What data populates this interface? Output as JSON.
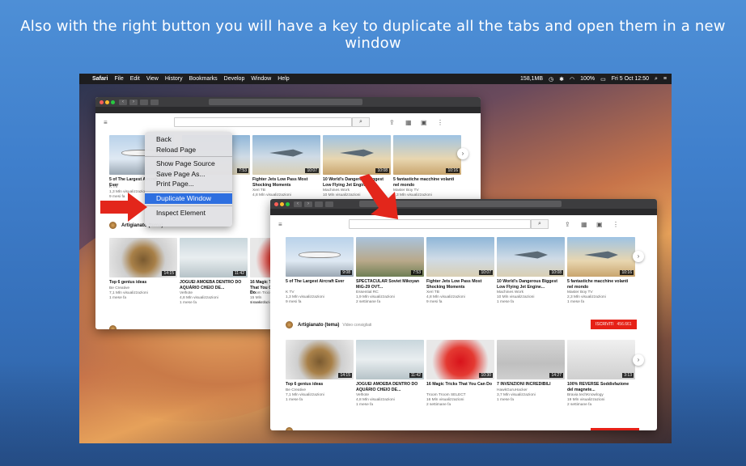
{
  "headline": "Also with the right button you will have a key to duplicate all the tabs and open them in a new window",
  "menubar": {
    "apple": "",
    "items": [
      "Safari",
      "File",
      "Edit",
      "View",
      "History",
      "Bookmarks",
      "Develop",
      "Window",
      "Help"
    ],
    "status": {
      "net": "158,1MB",
      "battery": "100%",
      "datetime": "Fri 5 Oct 12:50"
    }
  },
  "context_menu": {
    "items": [
      "Back",
      "Reload Page",
      "Show Page Source",
      "Save Page As...",
      "Print Page...",
      "Duplicate Window",
      "Inspect Element"
    ],
    "highlighted": "Duplicate Window"
  },
  "window_back": {
    "videos_row1": [
      {
        "title": "5 of The Largest Aircraft Ever",
        "channel": "K TV",
        "views": "1,3 Mln visualizzazioni",
        "ago": "9 mesi fa",
        "duration": ""
      },
      {
        "title": "Fighter Jets Low Pass Most Shocking Moments",
        "channel": "Xeri TB",
        "views": "4,8 Mln visualizzazioni",
        "ago": "",
        "duration": "7:53"
      },
      {
        "title": "10 World's Dangerous Biggest Low Flying Jet Engine...",
        "channel": "Machines Work",
        "views": "10 Mln visualizzazioni",
        "ago": "",
        "duration": "10:07"
      },
      {
        "title": "5 fantastiche macchine volanti nel mondo",
        "channel": "Master Boy TV",
        "views": "2,3 Mln visualizzazioni",
        "ago": "",
        "duration": "10:08"
      }
    ],
    "extra_duration": "10:16",
    "channel_name": "Artigianato (tema)",
    "videos_row2": [
      {
        "title": "Top 6 genius ideas",
        "channel": "Be Creative",
        "views": "7,1 Mln visualizzazioni",
        "ago": "1 mese fa",
        "duration": "14:15"
      },
      {
        "title": "JOGUEI AMOEBA DENTRO DO AQUÁRIO CHEIO DE...",
        "channel": "Velhote",
        "views": "4,8 Mln visualizzazioni",
        "ago": "1 mese fa",
        "duration": "11:42"
      },
      {
        "title": "16 Magic Tricks That You Can Do",
        "channel": "Troom Troom",
        "views": "15 Mln visualizzazioni",
        "ago": "1 mese fa",
        "duration": ""
      }
    ]
  },
  "window_front": {
    "videos_row1": [
      {
        "title": "5 of The Largest Aircraft Ever",
        "channel": "K TV",
        "views": "1,3 Mln visualizzazioni",
        "ago": "9 mesi fa",
        "duration": "9:08"
      },
      {
        "title": "SPECTACULAR Soviet Mikoyan MiG-29 OVT...",
        "channel": "Essential RC",
        "views": "1,9 Mln visualizzazioni",
        "ago": "2 settimane fa",
        "duration": "7:53"
      },
      {
        "title": "Fighter Jets Low Pass Most Shocking Moments",
        "channel": "Xeri TB",
        "views": "4,8 Mln visualizzazioni",
        "ago": "9 mesi fa",
        "duration": "10:07"
      },
      {
        "title": "10 World's Dangerous Biggest Low Flying Jet Engine...",
        "channel": "Machines Work",
        "views": "10 Mln visualizzazioni",
        "ago": "1 mese fa",
        "duration": "10:08"
      },
      {
        "title": "5 fantastiche macchine volanti nel mondo",
        "channel": "Master Boy TV",
        "views": "2,3 Mln visualizzazioni",
        "ago": "1 mese fa",
        "duration": "10:16"
      }
    ],
    "channel_name": "Artigianato (tema)",
    "channel_sub": "Video consigliati",
    "subscribe_label": "ISCRIVITI",
    "subscribe_count": "456.661",
    "videos_row2": [
      {
        "title": "Top 6 genius ideas",
        "channel": "Be Creative",
        "views": "7,1 Mln visualizzazioni",
        "ago": "1 mese fa",
        "duration": "14:15"
      },
      {
        "title": "JOGUEI AMOEBA DENTRO DO AQUÁRIO CHEIO DE...",
        "channel": "Velhote",
        "views": "4,8 Mln visualizzazioni",
        "ago": "1 mese fa",
        "duration": "11:42"
      },
      {
        "title": "16 Magic Tricks That You Can Do",
        "channel": "Troom Troom SELECT",
        "views": "16 Mln visualizzazioni",
        "ago": "2 settimane fa",
        "duration": "10:30"
      },
      {
        "title": "7 INVENZIONI INCREDIBILI",
        "channel": "HawkGuruHacker",
        "views": "3,7 Mln visualizzazioni",
        "ago": "1 mese fa",
        "duration": "14:27"
      },
      {
        "title": "100% REVERSE Soddisfazione del magnete...",
        "channel": "Bravia techKnowlogy",
        "views": "19 Mln visualizzazioni",
        "ago": "2 settimane fa",
        "duration": "3:13"
      }
    ]
  },
  "colors": {
    "highlight": "#2e6fe0",
    "subscribe": "#e62117",
    "arrow": "#e3261b"
  }
}
